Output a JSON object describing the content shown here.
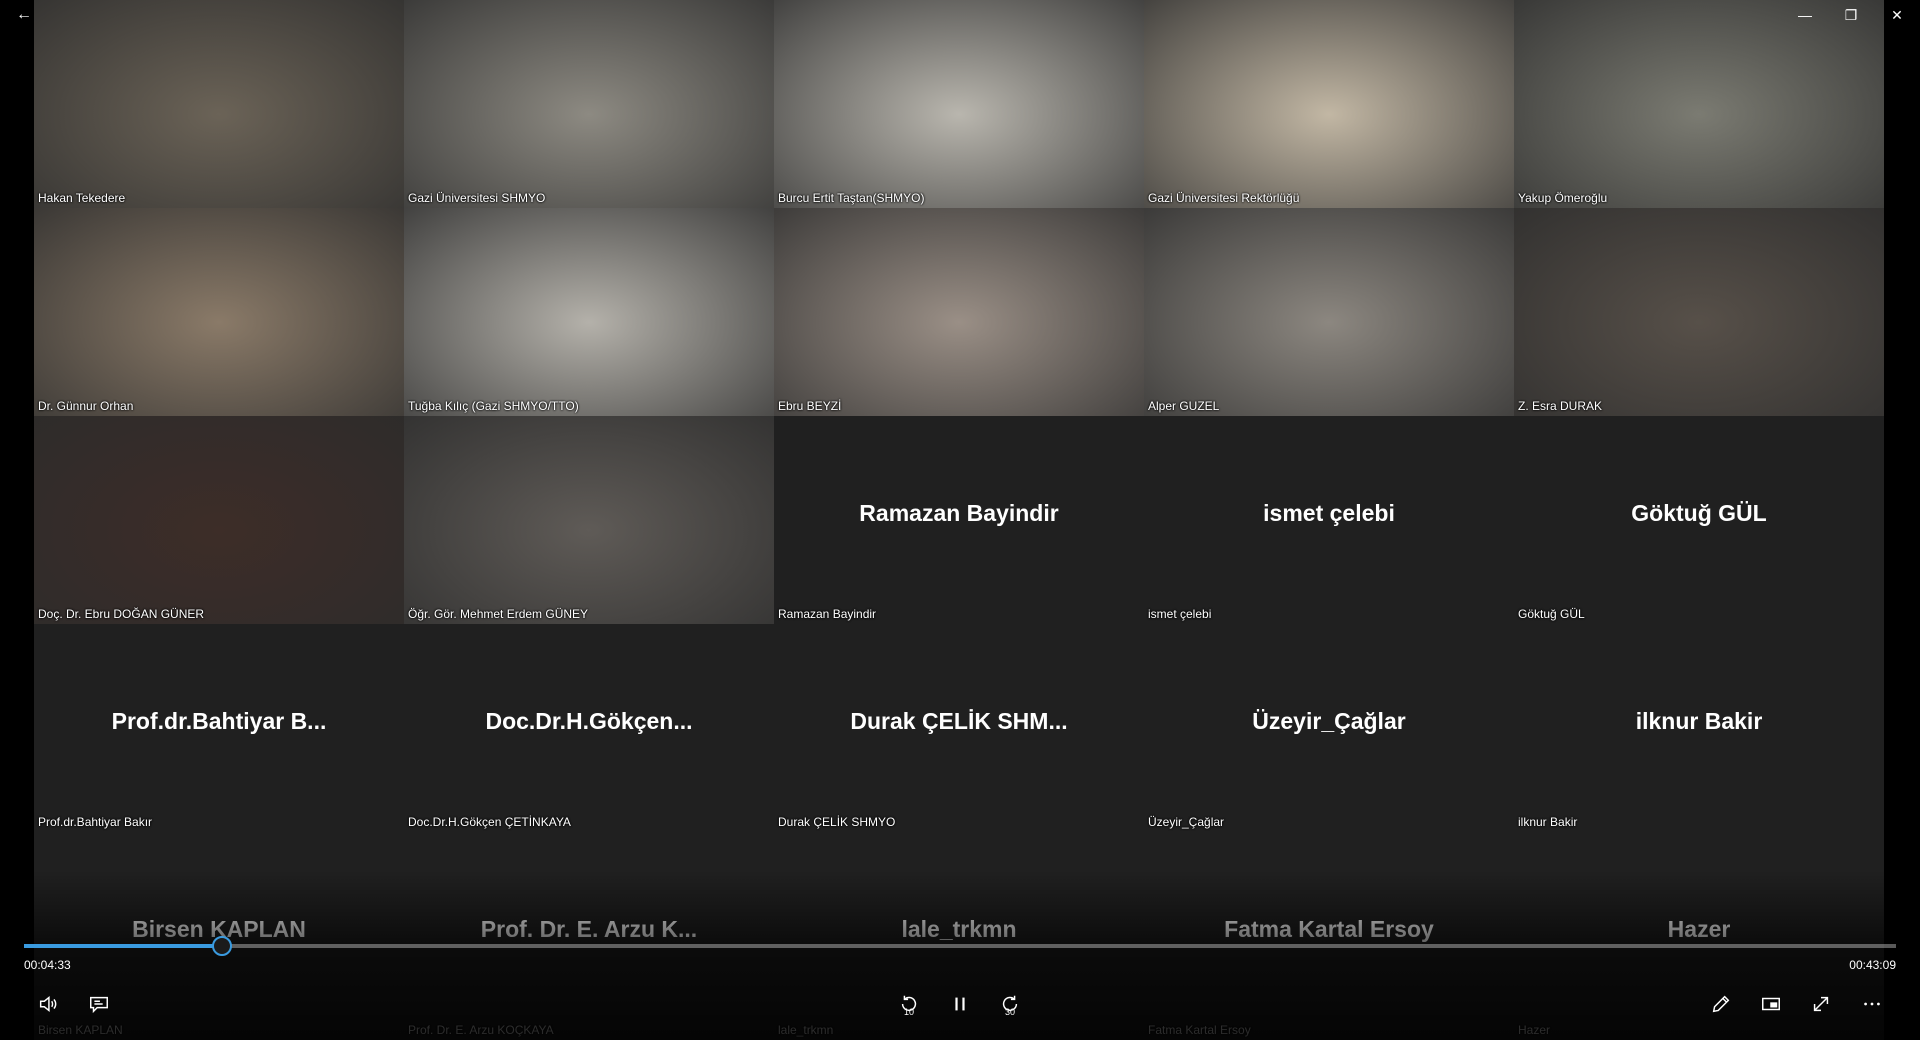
{
  "window": {
    "back": "←",
    "minimize": "—",
    "maximize": "❐",
    "close": "✕"
  },
  "participants": [
    {
      "caption": "Hakan Tekedere",
      "display": "",
      "video": true,
      "tone": "#6b6357"
    },
    {
      "caption": "Gazi Üniversitesi SHMYO",
      "display": "",
      "video": true,
      "tone": "#8d8a82"
    },
    {
      "caption": "Burcu Ertit Taştan(SHMYO)",
      "display": "",
      "video": true,
      "tone": "#b9b6ae"
    },
    {
      "caption": "Gazi Üniversitesi Rektörlüğü",
      "display": "",
      "video": true,
      "tone": "#c2b7a4"
    },
    {
      "caption": "Yakup Ömeroğlu",
      "display": "",
      "video": true,
      "tone": "#7b7b72"
    },
    {
      "caption": "Dr. Günnur Orhan",
      "display": "",
      "video": true,
      "tone": "#8a7a68"
    },
    {
      "caption": "Tuğba Kılıç (Gazi SHMYO/TTO)",
      "display": "",
      "video": true,
      "tone": "#b4b1aa"
    },
    {
      "caption": "Ebru BEYZİ",
      "display": "",
      "video": true,
      "tone": "#9a8f86"
    },
    {
      "caption": "Alper GUZEL",
      "display": "",
      "video": true,
      "tone": "#8c8780"
    },
    {
      "caption": "Z. Esra DURAK",
      "display": "",
      "video": true,
      "tone": "#575049"
    },
    {
      "caption": "Doç. Dr. Ebru DOĞAN GÜNER",
      "display": "",
      "video": true,
      "tone": "#3d2d28"
    },
    {
      "caption": "Öğr. Gör. Mehmet Erdem GÜNEY",
      "display": "",
      "video": true,
      "tone": "#5f5b57"
    },
    {
      "caption": "Ramazan Bayindir",
      "display": "Ramazan Bayindir",
      "video": false
    },
    {
      "caption": "ismet çelebi",
      "display": "ismet çelebi",
      "video": false
    },
    {
      "caption": "Göktuğ GÜL",
      "display": "Göktuğ GÜL",
      "video": false
    },
    {
      "caption": "Prof.dr.Bahtiyar Bakır",
      "display": "Prof.dr.Bahtiyar  B...",
      "video": false
    },
    {
      "caption": "Doc.Dr.H.Gökçen ÇETİNKAYA",
      "display": "Doc.Dr.H.Gökçen...",
      "video": false
    },
    {
      "caption": "Durak ÇELİK SHMYO",
      "display": "Durak ÇELİK SHM...",
      "video": false
    },
    {
      "caption": "Üzeyir_Çağlar",
      "display": "Üzeyir_Çağlar",
      "video": false
    },
    {
      "caption": "ilknur Bakir",
      "display": "ilknur Bakir",
      "video": false
    },
    {
      "caption": "Birsen KAPLAN",
      "display": "Birsen KAPLAN",
      "video": false
    },
    {
      "caption": "Prof. Dr. E. Arzu KOÇKAYA",
      "display": "Prof. Dr. E. Arzu K...",
      "video": false
    },
    {
      "caption": "lale_trkmn",
      "display": "lale_trkmn",
      "video": false
    },
    {
      "caption": "Fatma Kartal Ersoy",
      "display": "Fatma Kartal Ersoy",
      "video": false
    },
    {
      "caption": "Hazer",
      "display": "Hazer",
      "video": false
    }
  ],
  "player": {
    "current_time": "00:04:33",
    "total_time": "00:43:09",
    "progress": 0.105,
    "skip_back": "10",
    "skip_forward": "30",
    "accent": "#3a9be0"
  },
  "icons": {
    "volume": "volume-icon",
    "captions": "captions-icon",
    "rewind": "rewind-10-icon",
    "pause": "pause-icon",
    "forward": "forward-30-icon",
    "pen": "pen-icon",
    "miniplayer": "miniplayer-icon",
    "fullscreen": "fullscreen-icon",
    "more": "more-icon"
  }
}
